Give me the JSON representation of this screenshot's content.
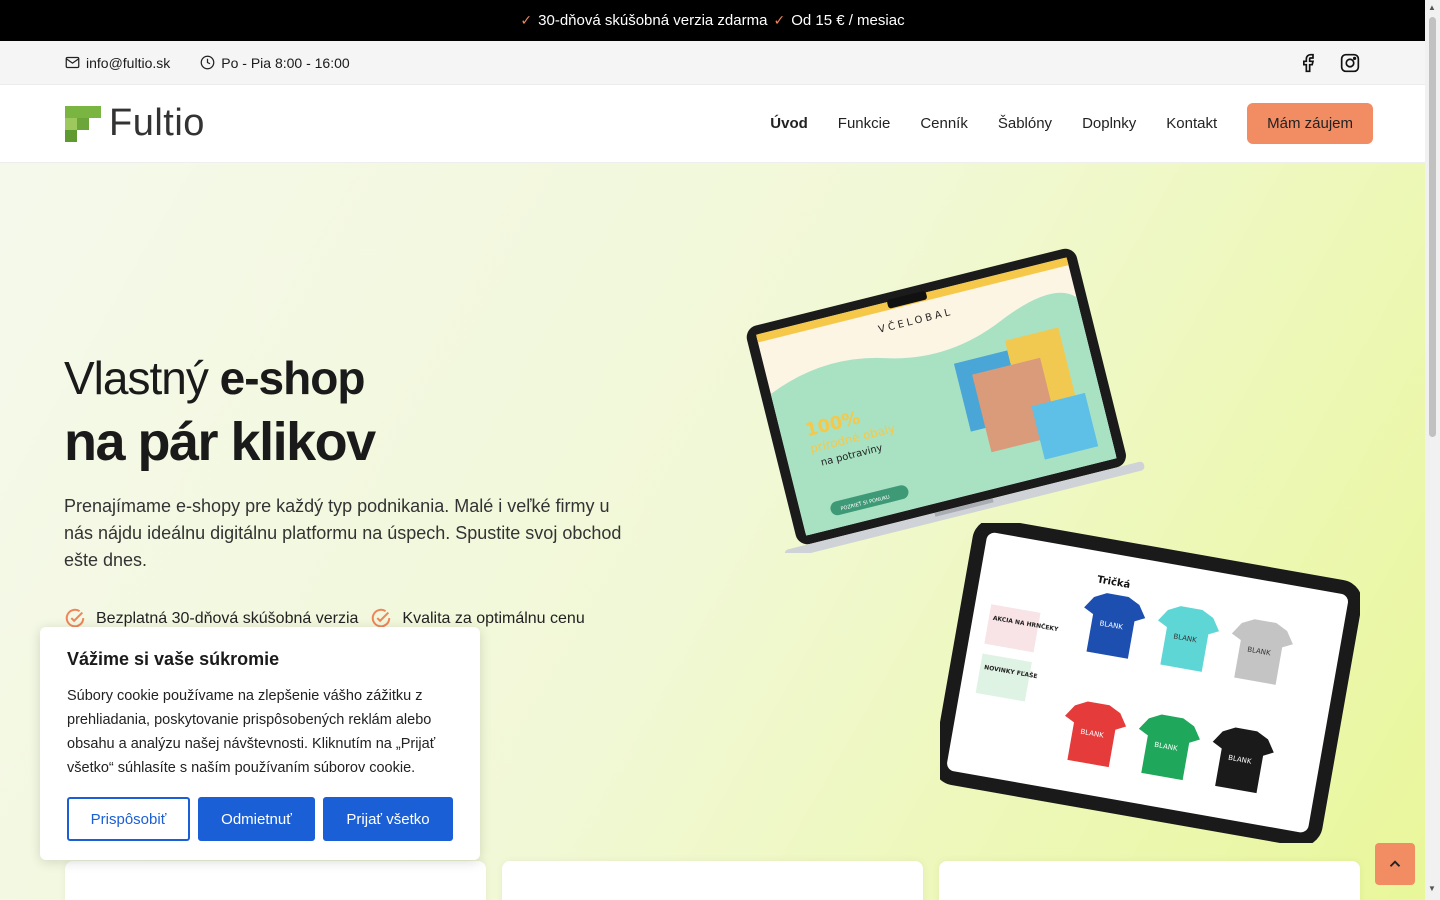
{
  "announcement": {
    "items": [
      "30-dňová skúšobná verzia zdarma",
      "Od 15 € / mesiac"
    ]
  },
  "topbar": {
    "email": "info@fultio.sk",
    "hours": "Po - Pia 8:00 - 16:00"
  },
  "header": {
    "logo_text": "Fultio",
    "nav": [
      "Úvod",
      "Funkcie",
      "Cenník",
      "Šablóny",
      "Doplnky",
      "Kontakt"
    ],
    "cta": "Mám záujem"
  },
  "hero": {
    "title_light": "Vlastný ",
    "title_bold": "e-shop",
    "title_line2": "na pár klikov",
    "description": "Prenajímame e-shopy pre každý typ podnikania. Malé i veľké firmy u nás nájdu ideálnu digitálnu platformu na úspech. Spustite svoj obchod ešte dnes.",
    "features": [
      "Bezplatná 30-dňová skúšobná verzia",
      "Kvalita za optimálnu cenu"
    ]
  },
  "laptop_screen": {
    "brand": "VČELOBAL",
    "headline1": "100%",
    "headline2": "prírodné obaly",
    "headline3": "na potraviny",
    "button": "POZRIEŤ SI PONUKU"
  },
  "tablet_screen": {
    "title": "Tričká",
    "promo1": "AKCIA NA HRNČEKY",
    "promo2": "NOVINKY FĽAŠE",
    "shirt_label": "BLANK"
  },
  "cookie": {
    "title": "Vážime si vaše súkromie",
    "text": "Súbory cookie používame na zlepšenie vášho zážitku z prehliadania, poskytovanie prispôsobených reklám alebo obsahu a analýzu našej návštevnosti. Kliknutím na „Prijať všetko“ súhlasíte s naším používaním súborov cookie.",
    "customize": "Prispôsobiť",
    "reject": "Odmietnuť",
    "accept": "Prijať všetko"
  },
  "colors": {
    "accent": "#f28c62",
    "cookie_blue": "#1a5fd6",
    "logo_green": "#7ab542"
  },
  "icons": [
    "check-icon",
    "mail-icon",
    "clock-icon",
    "facebook-icon",
    "instagram-icon",
    "chevron-up-icon"
  ]
}
